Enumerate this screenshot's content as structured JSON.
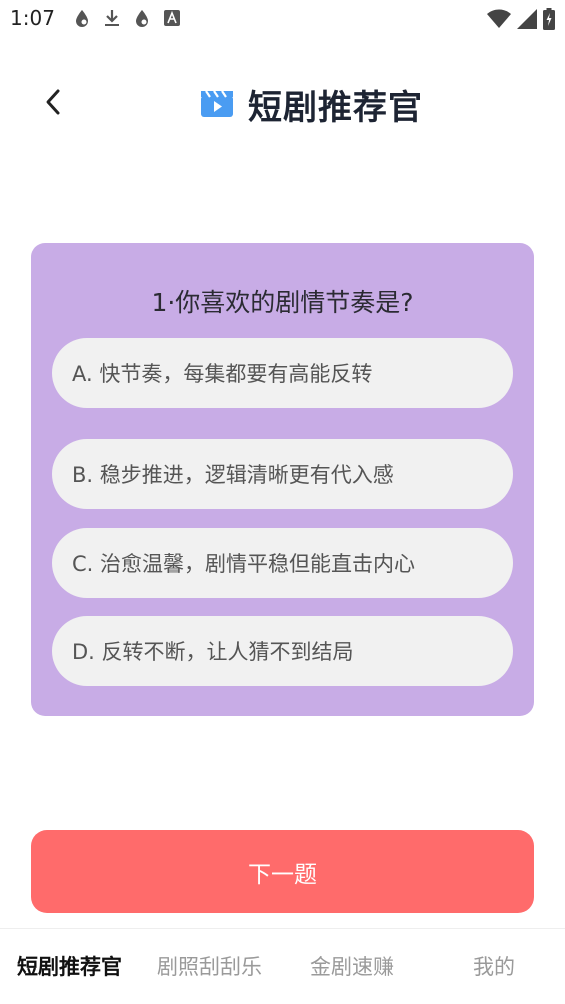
{
  "status_bar": {
    "time": "1:07",
    "left_icons": [
      "drop-icon",
      "download-icon",
      "drop-icon",
      "text-a-icon"
    ],
    "right_icons": [
      "wifi-icon",
      "cell-signal-icon",
      "battery-icon"
    ]
  },
  "header": {
    "title": "短剧推荐官",
    "icon": "clapperboard-icon"
  },
  "quiz": {
    "question": "1·你喜欢的剧情节奏是?",
    "options": [
      "A. 快节奏，每集都要有高能反转",
      "B. 稳步推进，逻辑清晰更有代入感",
      "C. 治愈温馨，剧情平稳但能直击内心",
      "D. 反转不断，让人猜不到结局"
    ]
  },
  "next_button": {
    "label": "下一题"
  },
  "bottom_nav": {
    "items": [
      {
        "label": "短剧推荐官",
        "active": true
      },
      {
        "label": "剧照刮刮乐",
        "active": false
      },
      {
        "label": "金剧速赚",
        "active": false
      },
      {
        "label": "我的",
        "active": false
      }
    ]
  },
  "colors": {
    "card_bg": "#c8ace6",
    "option_bg": "#f1f1f1",
    "primary_button": "#ff6b6b",
    "title_text": "#1d2433",
    "icon_blue": "#4a9cf2"
  }
}
